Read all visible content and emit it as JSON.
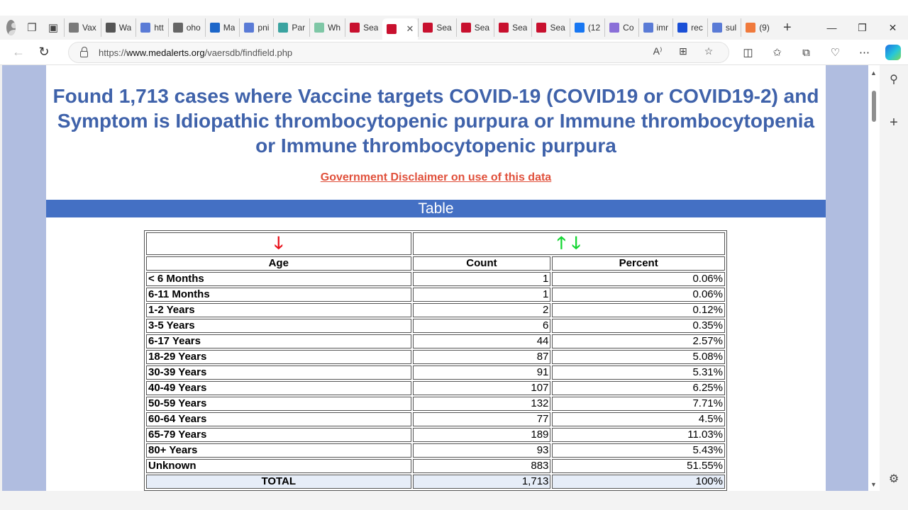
{
  "browser": {
    "tabs": [
      {
        "label": "Vax",
        "icon": "generic-tab-icon",
        "color": "#7a7a7a"
      },
      {
        "label": "Wa",
        "icon": "archive-icon",
        "color": "#555555"
      },
      {
        "label": "htt",
        "icon": "search-icon",
        "color": "#5a7bd6"
      },
      {
        "label": "oho",
        "icon": "document-icon",
        "color": "#666666"
      },
      {
        "label": "Ma",
        "icon": "outlook-icon",
        "color": "#1c66c9"
      },
      {
        "label": "pni",
        "icon": "search-icon",
        "color": "#5a7bd6"
      },
      {
        "label": "Par",
        "icon": "generic-tab-icon",
        "color": "#3aa3a0"
      },
      {
        "label": "Wh",
        "icon": "image-icon",
        "color": "#7fc7a6"
      },
      {
        "label": "Sea",
        "icon": "medalerts-icon",
        "color": "#c8102e"
      },
      {
        "label": "",
        "icon": "medalerts-icon",
        "color": "#c8102e",
        "active": true
      },
      {
        "label": "Sea",
        "icon": "medalerts-icon",
        "color": "#c8102e"
      },
      {
        "label": "Sea",
        "icon": "medalerts-icon",
        "color": "#c8102e"
      },
      {
        "label": "Sea",
        "icon": "medalerts-icon",
        "color": "#c8102e"
      },
      {
        "label": "Sea",
        "icon": "medalerts-icon",
        "color": "#c8102e"
      },
      {
        "label": "(12",
        "icon": "facebook-icon",
        "color": "#1877f2"
      },
      {
        "label": "Co",
        "icon": "copilot-icon",
        "color": "#8a6fd8"
      },
      {
        "label": "imr",
        "icon": "search-icon",
        "color": "#5a7bd6"
      },
      {
        "label": "rec",
        "icon": "search-icon",
        "color": "#1a4fd6"
      },
      {
        "label": "sul",
        "icon": "search-icon",
        "color": "#5a7bd6"
      },
      {
        "label": "(9)",
        "icon": "substack-icon",
        "color": "#f07a3c"
      }
    ],
    "url_prefix": "https://",
    "url_domain": "www.medalerts.org",
    "url_path": "/vaersdb/findfield.php"
  },
  "page": {
    "headline": "Found 1,713 cases where Vaccine targets COVID-19 (COVID19 or COVID19-2) and Symptom is Idiopathic thrombocytopenic purpura or Immune thrombocytopenia or Immune thrombocytopenic purpura",
    "disclaimer": "Government Disclaimer on use of this data",
    "section_title": "Table",
    "table": {
      "columns": [
        "Age",
        "Count",
        "Percent"
      ],
      "rows": [
        {
          "age": "< 6 Months",
          "count": "1",
          "percent": "0.06%"
        },
        {
          "age": "6-11 Months",
          "count": "1",
          "percent": "0.06%"
        },
        {
          "age": "1-2 Years",
          "count": "2",
          "percent": "0.12%"
        },
        {
          "age": "3-5 Years",
          "count": "6",
          "percent": "0.35%"
        },
        {
          "age": "6-17 Years",
          "count": "44",
          "percent": "2.57%"
        },
        {
          "age": "18-29 Years",
          "count": "87",
          "percent": "5.08%"
        },
        {
          "age": "30-39 Years",
          "count": "91",
          "percent": "5.31%"
        },
        {
          "age": "40-49 Years",
          "count": "107",
          "percent": "6.25%"
        },
        {
          "age": "50-59 Years",
          "count": "132",
          "percent": "7.71%"
        },
        {
          "age": "60-64 Years",
          "count": "77",
          "percent": "4.5%"
        },
        {
          "age": "65-79 Years",
          "count": "189",
          "percent": "11.03%"
        },
        {
          "age": "80+ Years",
          "count": "93",
          "percent": "5.43%"
        },
        {
          "age": "Unknown",
          "count": "883",
          "percent": "51.55%"
        }
      ],
      "total": {
        "label": "TOTAL",
        "count": "1,713",
        "percent": "100%"
      }
    }
  },
  "colors": {
    "headline": "#3f62aa",
    "section_bar": "#4470c4",
    "page_background": "#b0bde0",
    "disclaimer_link": "#e0503b",
    "sort_arrow_active": "#e8101a",
    "sort_arrow_inactive": "#15d633"
  }
}
